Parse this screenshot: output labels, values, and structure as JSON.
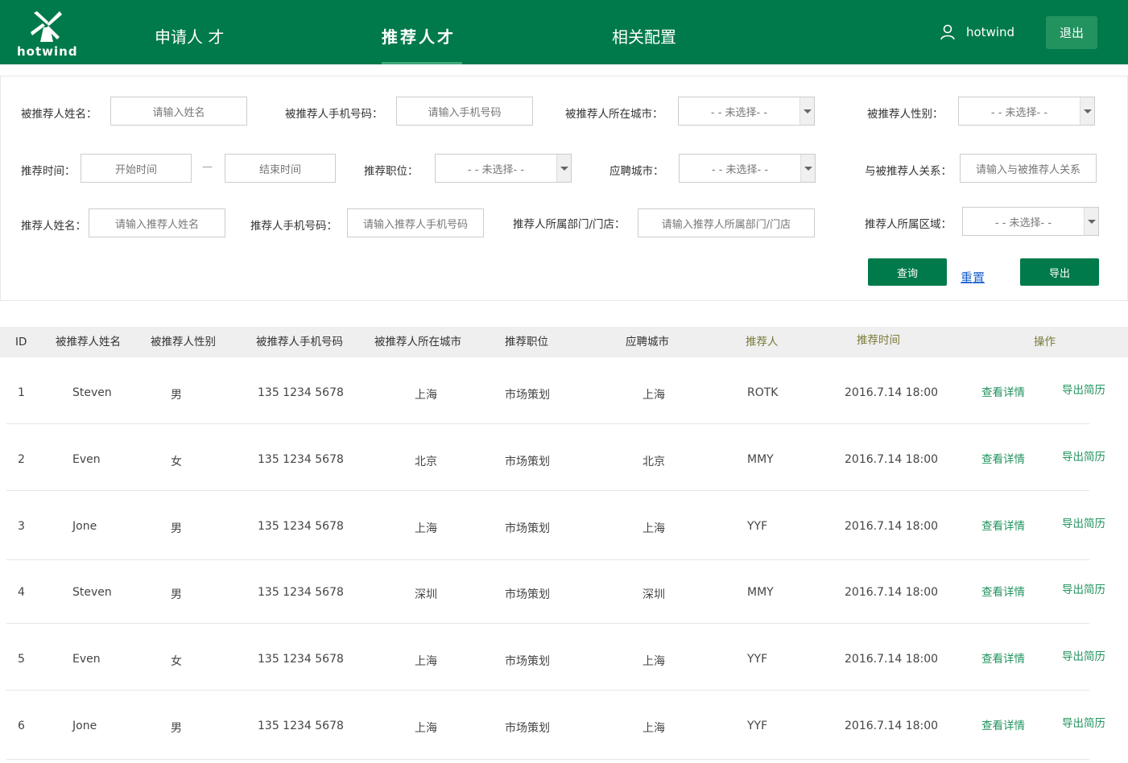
{
  "brand": {
    "logo_text": "hotwind"
  },
  "nav": {
    "items": [
      {
        "label": "申请人 才"
      },
      {
        "label": "推荐人才"
      },
      {
        "label": "相关配置"
      }
    ]
  },
  "user": {
    "name": "hotwind",
    "logout_label": "退出"
  },
  "filters": {
    "referee_name": {
      "label": "被推荐人姓名：",
      "placeholder": "请输入姓名"
    },
    "referee_phone": {
      "label": "被推荐人手机号码：",
      "placeholder": "请输入手机号码"
    },
    "referee_city": {
      "label": "被推荐人所在城市：",
      "value": "- - 未选择- -"
    },
    "referee_gender": {
      "label": "被推荐人性别：",
      "value": "- - 未选择- -"
    },
    "time": {
      "label": "推荐时间：",
      "start_placeholder": "开始时间",
      "separator": "—",
      "end_placeholder": "结束时间"
    },
    "position": {
      "label": "推荐职位：",
      "value": "- - 未选择- -"
    },
    "apply_city": {
      "label": "应聘城市：",
      "value": "- - 未选择- -"
    },
    "relation": {
      "label": "与被推荐人关系：",
      "placeholder": "请输入与被推荐人关系"
    },
    "referrer_name": {
      "label": "推荐人姓名：",
      "placeholder": "请输入推荐人姓名"
    },
    "referrer_phone": {
      "label": "推荐人手机号码：",
      "placeholder": "请输入推荐人手机号码"
    },
    "referrer_dept": {
      "label": "推荐人所属部门/门店：",
      "placeholder": "请输入推荐人所属部门/门店"
    },
    "referrer_region": {
      "label": "推荐人所属区域：",
      "value": "- - 未选择- -"
    },
    "buttons": {
      "query": "查询",
      "reset": "重置",
      "export": "导出"
    }
  },
  "table": {
    "headers": [
      "ID",
      "被推荐人姓名",
      "被推荐人性别",
      "被推荐人手机号码",
      "被推荐人所在城市",
      "推荐职位",
      "应聘城市",
      "推荐人",
      "推荐时间",
      "操作"
    ],
    "rows": [
      {
        "id": "1",
        "name": "Steven",
        "gender": "男",
        "phone": "135 1234 5678",
        "city": "上海",
        "position": "市场策划",
        "apply_city": "上海",
        "referrer": "ROTK",
        "time": "2016.7.14 18:00",
        "detail": "查看详情",
        "export": "导出简历"
      },
      {
        "id": "2",
        "name": "Even",
        "gender": "女",
        "phone": "135 1234 5678",
        "city": "北京",
        "position": "市场策划",
        "apply_city": "北京",
        "referrer": "MMY",
        "time": "2016.7.14 18:00",
        "detail": "查看详情",
        "export": "导出简历"
      },
      {
        "id": "3",
        "name": "Jone",
        "gender": "男",
        "phone": "135 1234 5678",
        "city": "上海",
        "position": "市场策划",
        "apply_city": "上海",
        "referrer": "YYF",
        "time": "2016.7.14 18:00",
        "detail": "查看详情",
        "export": "导出简历"
      },
      {
        "id": "4",
        "name": "Steven",
        "gender": "男",
        "phone": "135 1234 5678",
        "city": "深圳",
        "position": "市场策划",
        "apply_city": "深圳",
        "referrer": "MMY",
        "time": "2016.7.14 18:00",
        "detail": "查看详情",
        "export": "导出简历"
      },
      {
        "id": "5",
        "name": "Even",
        "gender": "女",
        "phone": "135 1234 5678",
        "city": "上海",
        "position": "市场策划",
        "apply_city": "上海",
        "referrer": "YYF",
        "time": "2016.7.14 18:00",
        "detail": "查看详情",
        "export": "导出简历"
      },
      {
        "id": "6",
        "name": "Jone",
        "gender": "男",
        "phone": "135 1234 5678",
        "city": "上海",
        "position": "市场策划",
        "apply_city": "上海",
        "referrer": "YYF",
        "time": "2016.7.14 18:00",
        "detail": "查看详情",
        "export": "导出简历"
      }
    ]
  },
  "colors": {
    "brand_green": "#007a4a",
    "link_green": "#22935e",
    "reset_blue": "#1a62c9"
  }
}
